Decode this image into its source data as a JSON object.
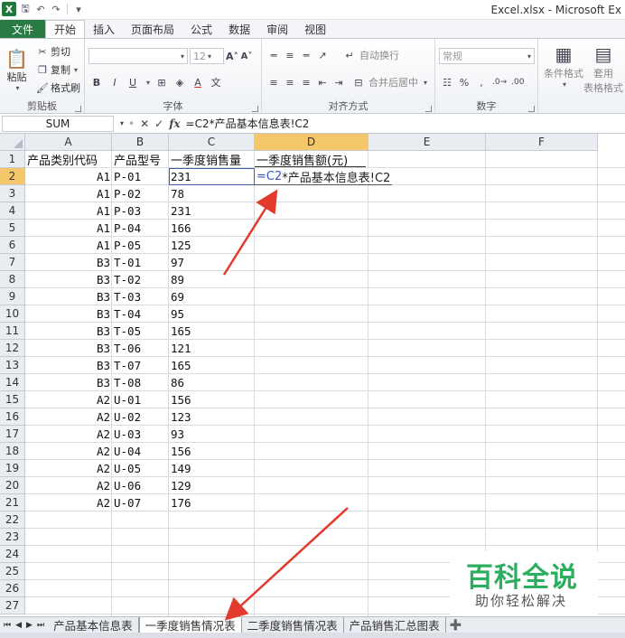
{
  "window": {
    "title": "Excel.xlsx - Microsoft Ex",
    "logo_letter": "X"
  },
  "ribbon": {
    "tabs": [
      "开始",
      "插入",
      "页面布局",
      "公式",
      "数据",
      "审阅",
      "视图"
    ],
    "file_tab": "文件",
    "clipboard": {
      "paste": "粘贴",
      "cut": "剪切",
      "copy": "复制",
      "format_painter": "格式刷",
      "label": "剪贴板"
    },
    "font": {
      "size": "12",
      "label": "字体"
    },
    "alignment": {
      "wrap": "自动换行",
      "merge": "合并后居中",
      "label": "对齐方式"
    },
    "number": {
      "format": "常规",
      "label": "数字"
    },
    "styles": {
      "conditional": "条件格式",
      "table_format_1": "套用",
      "table_format_2": "表格格式"
    }
  },
  "formula_bar": {
    "name_box": "SUM",
    "formula": "=C2*产品基本信息表!C2"
  },
  "columns": [
    "A",
    "B",
    "C",
    "D",
    "E",
    "F"
  ],
  "selected_column": "D",
  "headers": {
    "a": "产品类别代码",
    "b": "产品型号",
    "c": "一季度销售量",
    "d": "一季度销售额(元)"
  },
  "editing_cell": {
    "ref_part": "=C2",
    "rest_part": "*产品基本信息表!C2"
  },
  "rows": [
    {
      "a": "A1",
      "b": "P-01",
      "c": "231"
    },
    {
      "a": "A1",
      "b": "P-02",
      "c": "78"
    },
    {
      "a": "A1",
      "b": "P-03",
      "c": "231"
    },
    {
      "a": "A1",
      "b": "P-04",
      "c": "166"
    },
    {
      "a": "A1",
      "b": "P-05",
      "c": "125"
    },
    {
      "a": "B3",
      "b": "T-01",
      "c": "97"
    },
    {
      "a": "B3",
      "b": "T-02",
      "c": "89"
    },
    {
      "a": "B3",
      "b": "T-03",
      "c": "69"
    },
    {
      "a": "B3",
      "b": "T-04",
      "c": "95"
    },
    {
      "a": "B3",
      "b": "T-05",
      "c": "165"
    },
    {
      "a": "B3",
      "b": "T-06",
      "c": "121"
    },
    {
      "a": "B3",
      "b": "T-07",
      "c": "165"
    },
    {
      "a": "B3",
      "b": "T-08",
      "c": "86"
    },
    {
      "a": "A2",
      "b": "U-01",
      "c": "156"
    },
    {
      "a": "A2",
      "b": "U-02",
      "c": "123"
    },
    {
      "a": "A2",
      "b": "U-03",
      "c": "93"
    },
    {
      "a": "A2",
      "b": "U-04",
      "c": "156"
    },
    {
      "a": "A2",
      "b": "U-05",
      "c": "149"
    },
    {
      "a": "A2",
      "b": "U-06",
      "c": "129"
    },
    {
      "a": "A2",
      "b": "U-07",
      "c": "176"
    }
  ],
  "row_numbers": [
    "1",
    "2",
    "3",
    "4",
    "5",
    "6",
    "7",
    "8",
    "9",
    "10",
    "11",
    "12",
    "13",
    "14",
    "15",
    "16",
    "17",
    "18",
    "19",
    "20",
    "21",
    "22",
    "23",
    "24",
    "25",
    "26",
    "27"
  ],
  "sheet_tabs": [
    "产品基本信息表",
    "一季度销售情况表",
    "二季度销售情况表",
    "产品销售汇总图表"
  ],
  "active_sheet": "一季度销售情况表",
  "watermark": {
    "title": "百科全说",
    "subtitle": "助你轻松解决"
  },
  "colors": {
    "file_tab": "#2a7a43",
    "selected_header": "#f5c76b",
    "annotation_arrow": "#e23b2e",
    "watermark_green": "#2cae5e"
  }
}
